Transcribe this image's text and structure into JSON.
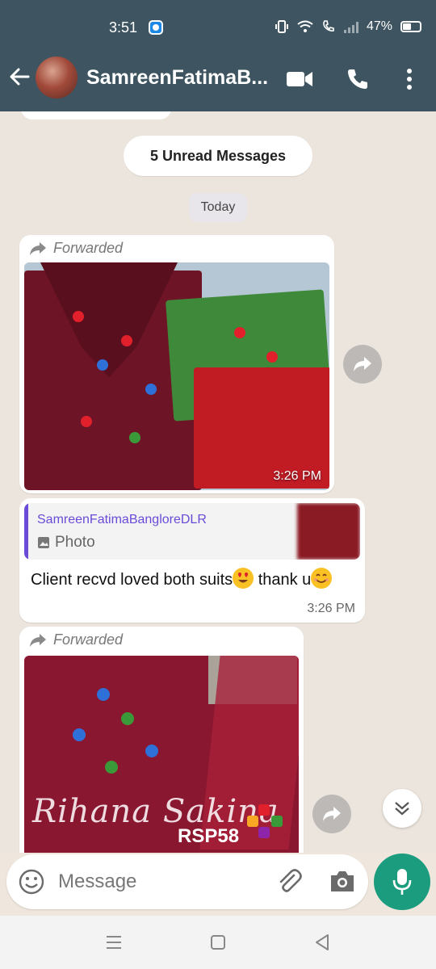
{
  "status_bar": {
    "time": "3:51",
    "battery": "47%"
  },
  "header": {
    "contact_name": "SamreenFatimaB...",
    "icons": [
      "back-arrow-icon",
      "video-call-icon",
      "voice-call-icon",
      "more-vert-icon"
    ]
  },
  "chat": {
    "unread_banner": "5 Unread Messages",
    "date_divider": "Today",
    "messages": [
      {
        "forwarded_label": "Forwarded",
        "type": "photo",
        "time": "3:26 PM"
      },
      {
        "type": "text-reply",
        "quoted_sender": "SamreenFatimaBangloreDLR",
        "quoted_type": "Photo",
        "text_a": "Client recvd loved both suits",
        "text_b": " thank u",
        "time": "3:26 PM"
      },
      {
        "forwarded_label": "Forwarded",
        "type": "photo",
        "watermark": "Rihana Sakina",
        "code": "RSP58"
      }
    ]
  },
  "composer": {
    "placeholder": "Message"
  },
  "colors": {
    "header": "#3e5561",
    "accent": "#1b9c7f",
    "quote_accent": "#6a4bd8",
    "chat_bg": "#ece5dd"
  }
}
